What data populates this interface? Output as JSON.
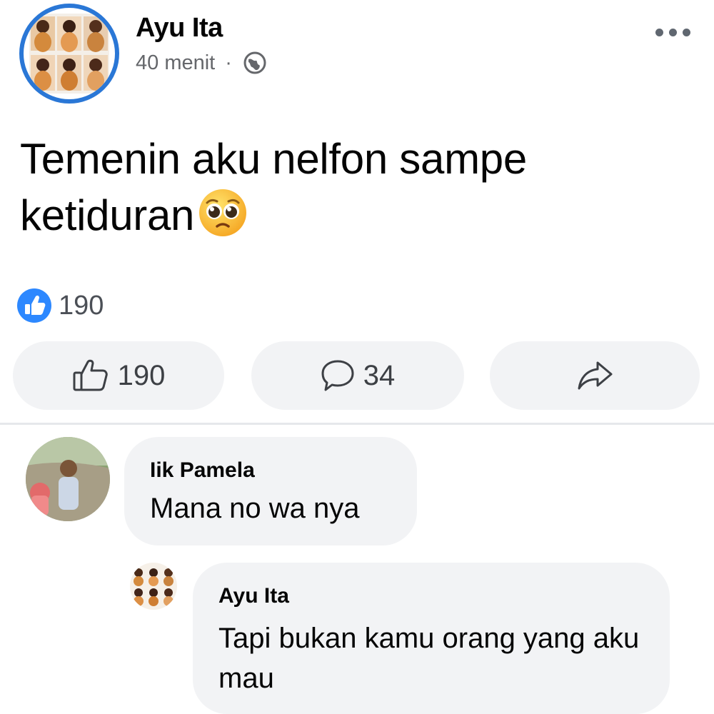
{
  "post": {
    "author": "Ayu Ita",
    "time": "40 menit",
    "separator": "·",
    "privacy_icon": "globe-icon",
    "menu_icon": "more-options-icon",
    "text": "Temenin aku nelfon sampe ketiduran",
    "emoji": "pleading-face-emoji"
  },
  "reactions": {
    "summary_icon": "like-reaction-icon",
    "summary_count": "190"
  },
  "actions": {
    "like_count": "190",
    "comment_count": "34",
    "share_icon": "share-arrow-icon"
  },
  "comments": [
    {
      "name": "Iik Pamela",
      "text": "Mana no wa nya"
    },
    {
      "name": "Ayu Ita",
      "text": "Tapi bukan kamu orang yang aku mau"
    }
  ],
  "colors": {
    "accent": "#1877f2",
    "avatar_ring": "#2a77d6",
    "button_bg": "#f2f3f5",
    "muted_text": "#65676b"
  }
}
